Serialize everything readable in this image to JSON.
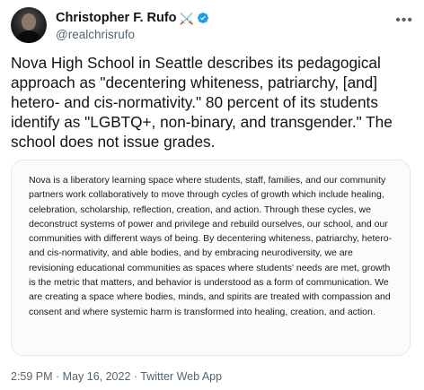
{
  "author": {
    "display_name": "Christopher F. Rufo",
    "handle": "@realchrisrufo",
    "name_emoji": "⚔️"
  },
  "tweet": {
    "text": "Nova High School in Seattle describes its pedagogical approach as \"decentering whiteness, patriarchy, [and] hetero- and cis-normativity.\" 80 percent of its students identify as \"LGBTQ+, non-binary, and transgender.\" The school does not issue grades."
  },
  "quoted_image": {
    "text": "Nova is a liberatory learning space where students, staff, families, and our community partners work collaboratively to move through cycles of growth which include healing, celebration, scholarship, reflection, creation, and action. Through these cycles, we deconstruct systems of power and privilege and rebuild ourselves, our school, and our communities with different ways of being. By decentering whiteness, patriarchy, hetero- and cis-normativity, and able bodies, and by embracing neurodiversity, we are revisioning educational communities as spaces where students' needs are met, growth is the metric that matters, and behavior is understood as a form of communication. We are creating a space where bodies, minds, and spirits are treated with compassion and consent and where systemic harm is transformed into healing, creation, and action."
  },
  "meta": {
    "timestamp": "2:59 PM · May 16, 2022 · Twitter Web App"
  },
  "colors": {
    "verified": "#1d9bf0",
    "secondary_text": "#536471",
    "quote_background": "#fbfbf9"
  }
}
